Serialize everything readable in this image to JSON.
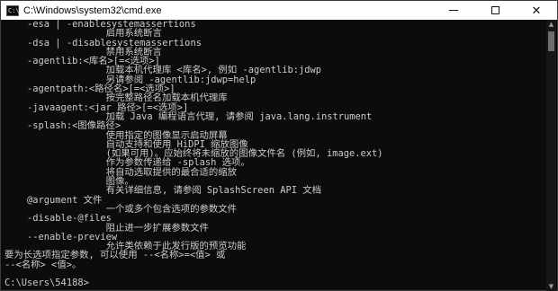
{
  "window": {
    "title": "C:\\Windows\\system32\\cmd.exe",
    "icon_text": "C:\\",
    "minimize_icon": "minimize-icon",
    "maximize_icon": "maximize-icon",
    "close_glyph": "✕",
    "scroll_up_glyph": "▲",
    "scroll_down_glyph": "▼"
  },
  "console": {
    "lines": [
      "    -esa | -enablesystemassertions",
      "                  启用系统断言",
      "    -dsa | -disablesystemassertions",
      "                  禁用系统断言",
      "    -agentlib:<库名>[=<选项>]",
      "                  加载本机代理库 <库名>, 例如 -agentlib:jdwp",
      "                  另请参阅 -agentlib:jdwp=help",
      "    -agentpath:<路径名>[=<选项>]",
      "                  按完整路径名加载本机代理库",
      "    -javaagent:<jar 路径>[=<选项>]",
      "                  加载 Java 编程语言代理, 请参阅 java.lang.instrument",
      "    -splash:<图像路径>",
      "                  使用指定的图像显示启动屏幕",
      "                  自动支持和使用 HiDPI 缩放图像",
      "                  (如果可用)。应始终将未缩放的图像文件名 (例如, image.ext)",
      "                  作为参数传递给 -splash 选项。",
      "                  将自动选取提供的最合适的缩放",
      "                  图像。",
      "                  有关详细信息, 请参阅 SplashScreen API 文档",
      "    @argument 文件",
      "                  一个或多个包含选项的参数文件",
      "    -disable-@files",
      "                  阻止进一步扩展参数文件",
      "    --enable-preview",
      "                  允许类依赖于此发行版的预览功能",
      "要为长选项指定参数, 可以使用 --<名称>=<值> 或",
      "--<名称> <值>。",
      "",
      "C:\\Users\\54188>"
    ]
  }
}
